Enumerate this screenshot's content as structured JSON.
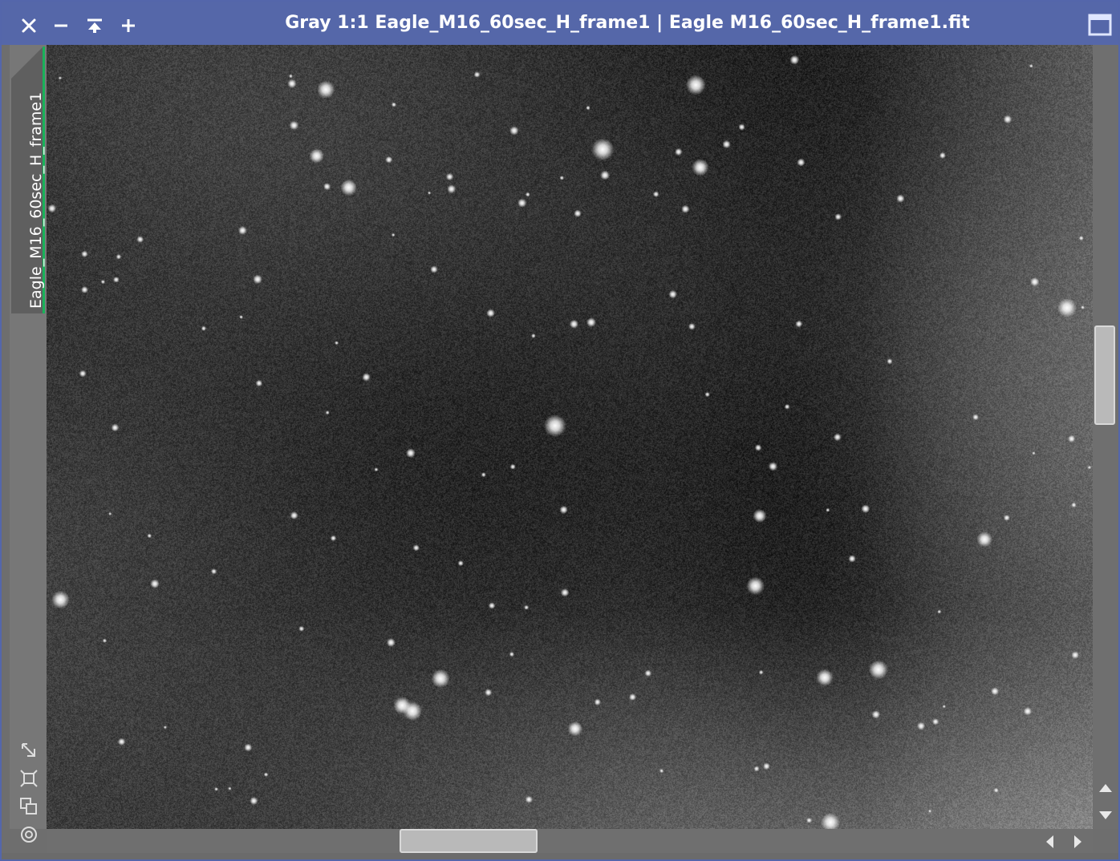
{
  "window": {
    "title": "Gray 1:1 Eagle_M16_60sec_H_frame1 | Eagle M16_60sec_H_frame1.fit",
    "titlebar_color": "#5567a9",
    "buttons": {
      "close": "close-icon",
      "minimize": "minimize-icon",
      "shade": "shade-icon",
      "maximize_plus": "plus-icon",
      "maximize": "maximize-icon"
    }
  },
  "view_tab": {
    "label": "Eagle_M16_60sec_H_frame1",
    "accent_color": "#19b25a"
  },
  "side_tools": [
    {
      "name": "fit-to-window-icon"
    },
    {
      "name": "zoom-to-fit-icon"
    },
    {
      "name": "clone-view-icon"
    },
    {
      "name": "target-icon"
    }
  ],
  "image": {
    "description_free": true,
    "mode": "Gray",
    "zoom": "1:1"
  }
}
